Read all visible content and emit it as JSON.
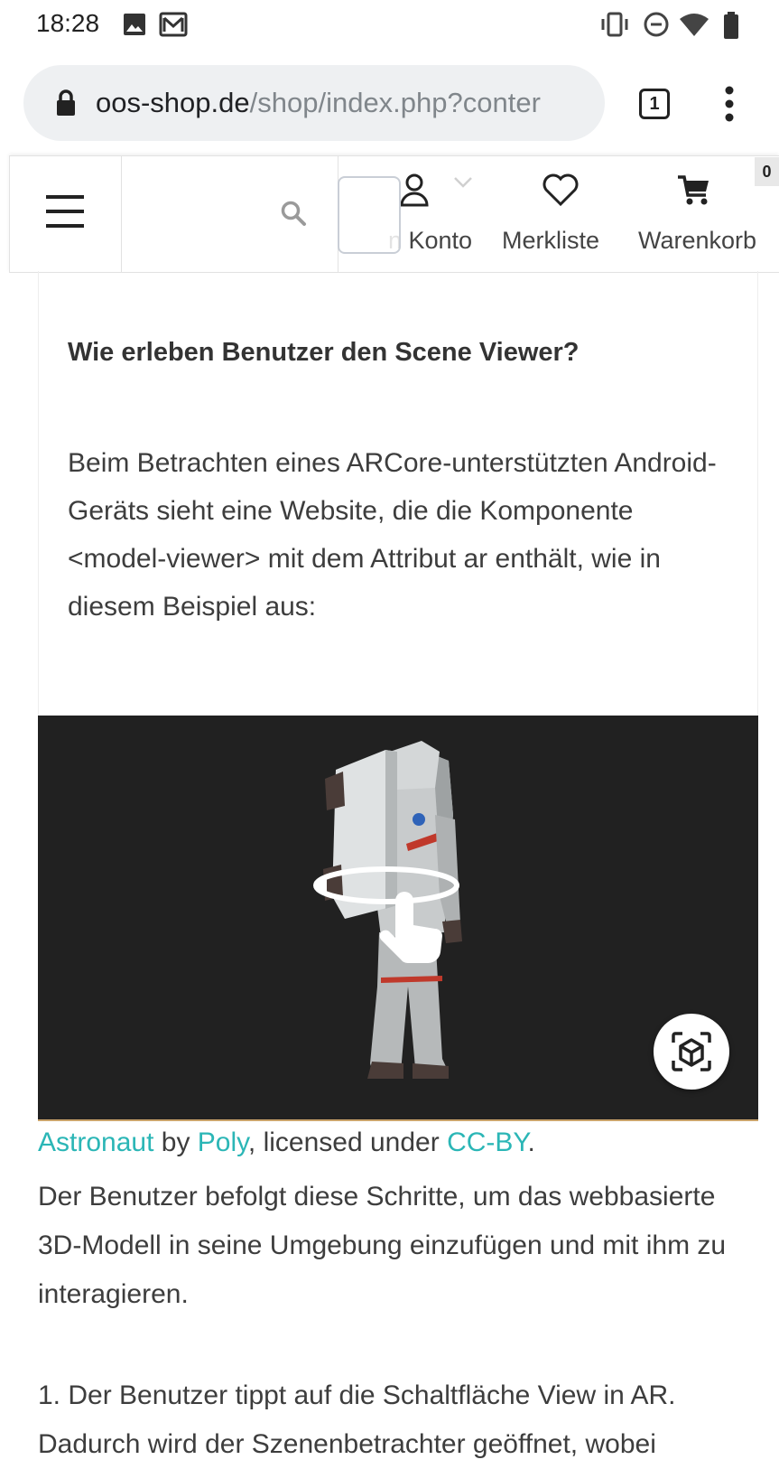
{
  "status_bar": {
    "time": "18:28",
    "icons": [
      "image-icon",
      "gmail-icon",
      "vibrate-icon",
      "dnd-icon",
      "wifi-icon",
      "battery-icon"
    ]
  },
  "browser": {
    "url_domain": "oos-shop.de",
    "url_path": "/shop/index.php?conter",
    "tab_count": "1"
  },
  "header": {
    "account_label": "n Konto",
    "wishlist_label": "Merkliste",
    "cart_label": "Warenkorb",
    "cart_badge": "0"
  },
  "content": {
    "heading": "Wie erleben Benutzer den Scene Viewer?",
    "paragraph1": "Beim Betrachten eines ARCore-unterstützten Android-Geräts sieht eine Website, die die Komponente <model-viewer> mit dem Attribut ar enthält, wie in diesem Beispiel aus:",
    "caption": {
      "link1": "Astronaut",
      "text1": " by ",
      "link2": "Poly",
      "text2": ", licensed under ",
      "link3": "CC-BY",
      "text3": "."
    },
    "paragraph2": "Der Benutzer befolgt diese Schritte, um das webbasierte 3D-Modell in seine Umgebung einzufügen und mit ihm zu interagieren.",
    "paragraph3_line1": "1. Der Benutzer tippt auf die Schaltfläche View in AR.",
    "paragraph3_line2": "Dadurch wird der Szenenbetrachter geöffnet, wobei"
  },
  "colors": {
    "link": "#2bb6b6",
    "viewer_bg": "#212121",
    "url_bar_bg": "#eef0f2"
  }
}
